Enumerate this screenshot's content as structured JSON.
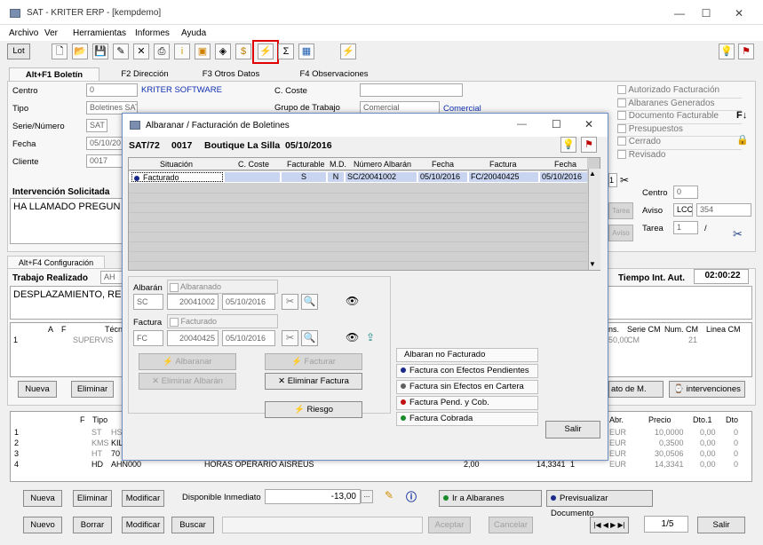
{
  "window": {
    "title": "SAT - KRITER ERP - [kempdemo]",
    "minimize": "—",
    "maximize": "☐",
    "close": "✕"
  },
  "menu": [
    "Archivo",
    "Ver",
    "Herramientas",
    "Informes",
    "Ayuda"
  ],
  "toolbar": {
    "lot_label": "Lot"
  },
  "tabs": [
    "Alt+F1 Boletín",
    "F2 Dirección",
    "F3 Otros Datos",
    "F4 Observaciones"
  ],
  "form": {
    "centro_label": "Centro",
    "centro_value": "0",
    "centro_name": "KRITER SOFTWARE",
    "tipo_label": "Tipo",
    "tipo_value": "Boletines SAT",
    "serie_label": "Serie/Número",
    "serie_value": "SAT",
    "fecha_label": "Fecha",
    "fecha_value": "05/10/20",
    "cliente_label": "Cliente",
    "cliente_value": "0017",
    "ccoste_label": "C. Coste",
    "grupo_label": "Grupo de Trabajo",
    "grupo_value": "Comercial",
    "grupo_value2": "Comercial"
  },
  "checks": [
    "Autorizado Facturación",
    "Albaranes Generados",
    "Documento Facturable",
    "Presupuestos",
    "Cerrado",
    "Revisado"
  ],
  "intervencion": {
    "label": "Intervención Solicitada",
    "text": "HA LLAMADO PREGUN"
  },
  "right_panel": {
    "centro_label": "Centro",
    "centro_value": "0",
    "aviso_label": "Aviso",
    "aviso_code": "LCC",
    "aviso_num": "354",
    "tarea_label": "Tarea",
    "tarea_value": "1",
    "tarea_sep": "/",
    "tarea_btn": "Tarea",
    "aviso_btn": "Aviso",
    "f_key": "F↓"
  },
  "config_tab": "Alt+F4 Configuración",
  "trabajo": {
    "label": "Trabajo Realizado",
    "code": "AH",
    "text": "DESPLAZAMIENTO, RE",
    "tiempo_label": "Tiempo Int. Aut.",
    "tiempo_value": "02:00:22"
  },
  "grid1": {
    "headers": [
      "A",
      "F",
      "Técnico"
    ],
    "row_num": "1",
    "row_tec": "SUPERVIS",
    "right_headers": [
      "ns.",
      "Serie CM",
      "Num. CM",
      "Linea CM"
    ],
    "right_vals": [
      "50,00",
      "CM",
      "21"
    ]
  },
  "grid1_buttons": {
    "nueva": "Nueva",
    "eliminar": "Eliminar",
    "dato": "ato de M.",
    "intervenciones": "intervenciones"
  },
  "grid2": {
    "headers": [
      "F",
      "Tipo"
    ],
    "rows": [
      {
        "n": "1",
        "tipo": "ST",
        "code": "HS"
      },
      {
        "n": "2",
        "tipo": "KMS",
        "code": "KIL"
      },
      {
        "n": "3",
        "tipo": "HT",
        "code": "70"
      },
      {
        "n": "4",
        "tipo": "HD",
        "code": "AHN000"
      }
    ],
    "row4_desc": "HORAS OPERARIO AISREUS",
    "row4_qty": "2,00",
    "row4_price": "14,3341",
    "row4_extra": "1",
    "right_headers": [
      "Abr.",
      "Precio",
      "Dto.1",
      "Dto"
    ],
    "right_rows": [
      [
        "EUR",
        "10,0000",
        "0,00",
        "0"
      ],
      [
        "EUR",
        "0,3500",
        "0,00",
        "0"
      ],
      [
        "EUR",
        "30,0506",
        "0,00",
        "0"
      ],
      [
        "EUR",
        "14,3341",
        "0,00",
        "0"
      ]
    ]
  },
  "bottom1": {
    "nueva": "Nueva",
    "eliminar": "Eliminar",
    "modificar": "Modificar",
    "disponible_label": "Disponible Inmediato",
    "disponible_value": "-13,00",
    "ir_albaranes": "Ir a Albaranes",
    "previsualizar": "Previsualizar Documento"
  },
  "bottom2": {
    "nuevo": "Nuevo",
    "borrar": "Borrar",
    "modificar": "Modificar",
    "buscar": "Buscar",
    "aceptar": "Aceptar",
    "cancelar": "Cancelar",
    "page": "1/5",
    "salir": "Salir"
  },
  "dialog": {
    "title": "Albaranar / Facturación de Boletines",
    "minimize": "—",
    "maximize": "☐",
    "close": "✕",
    "header_code": "SAT/72",
    "header_num": "0017",
    "header_name": "Boutique La Silla",
    "header_date": "05/10/2016",
    "columns": [
      "Situación",
      "C. Coste",
      "Facturable",
      "M.D.",
      "Número Albarán",
      "Fecha",
      "Factura",
      "Fecha"
    ],
    "row": {
      "situacion": "Facturado",
      "ccoste": "",
      "facturable": "S",
      "md": "N",
      "albaran": "SC/20041002",
      "fecha": "05/10/2016",
      "factura": "FC/20040425",
      "fecha2": "05/10/2016"
    },
    "albaran_label": "Albarán",
    "albaranado_label": "Albaranado",
    "alb_serie": "SC",
    "alb_num": "20041002",
    "alb_fecha": "05/10/2016",
    "factura_label": "Factura",
    "facturado_label": "Facturado",
    "fac_serie": "FC",
    "fac_num": "20040425",
    "fac_fecha": "05/10/2016",
    "btn_albaranar": "Albaranar",
    "btn_facturar": "Facturar",
    "btn_eliminar_albaran": "Eliminar Albarán",
    "btn_eliminar_factura": "Eliminar Factura",
    "btn_riesgo": "Riesgo",
    "legend": [
      "Albaran no Facturado",
      "Factura con Efectos Pendientes",
      "Factura sin Efectos en Cartera",
      "Factura Pend. y Cob.",
      "Factura Cobrada"
    ],
    "legend_colors": [
      "#ffffff",
      "#1a2a8a",
      "#606060",
      "#c01010",
      "#1a8a2a"
    ],
    "salir": "Salir"
  }
}
